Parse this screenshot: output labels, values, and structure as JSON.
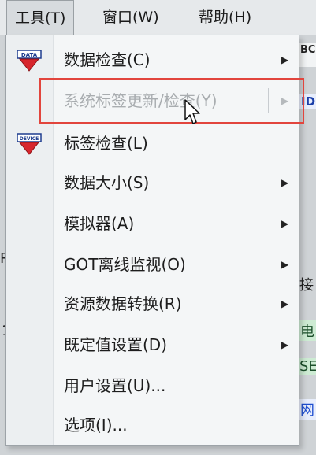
{
  "menubar": {
    "tools": "工具(T)",
    "window": "窗口(W)",
    "help": "帮助(H)"
  },
  "background": {
    "bc": "BC",
    "id": "ID",
    "r": "R",
    "one": "1",
    "connect": "接",
    "electric": "电",
    "se": "SE",
    "net": "网"
  },
  "menu": {
    "items": [
      {
        "label": "数据检查(C)",
        "submenu": true
      },
      {
        "label": "系统标签更新/检查(Y)",
        "submenu": true,
        "disabled": true
      },
      {
        "label": "标签检查(L)",
        "submenu": false
      },
      {
        "label": "数据大小(S)",
        "submenu": true
      },
      {
        "label": "模拟器(A)",
        "submenu": true
      },
      {
        "label": "GOT离线监视(O)",
        "submenu": true
      },
      {
        "label": "资源数据转换(R)",
        "submenu": true
      },
      {
        "label": "既定值设置(D)",
        "submenu": true
      },
      {
        "label": "用户设置(U)...",
        "submenu": false
      },
      {
        "label": "选项(I)...",
        "submenu": false
      }
    ],
    "icons": {
      "data_check": "DATA",
      "tag_check": "DEVICE"
    }
  },
  "colors": {
    "highlight_border": "#e2453d",
    "disabled_text": "#a9adb0"
  }
}
